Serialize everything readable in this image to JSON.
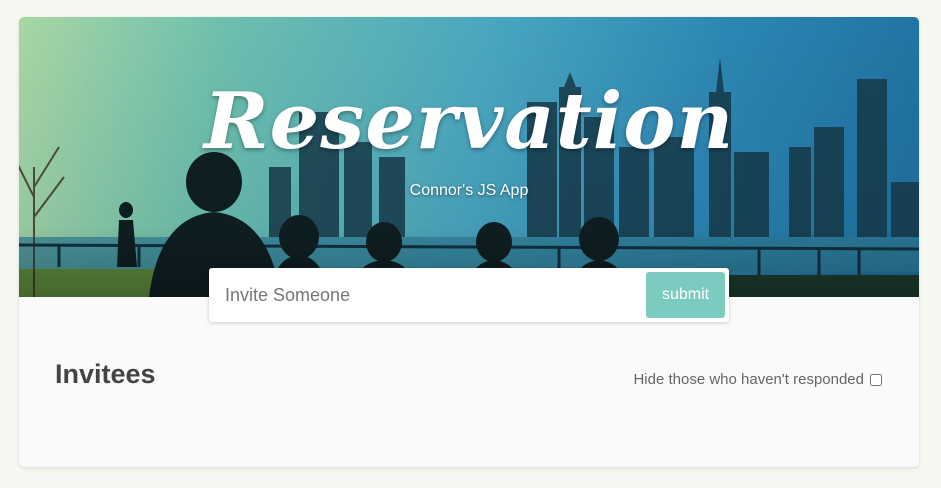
{
  "header": {
    "title": "Reservation",
    "subtitle": "Connor's JS App"
  },
  "form": {
    "placeholder": "Invite Someone",
    "value": "",
    "submit_label": "submit"
  },
  "invitees": {
    "heading": "Invitees",
    "filter_label": "Hide those who haven't responded",
    "filter_checked": false
  },
  "colors": {
    "accent": "#7ccbc1",
    "heading": "#444444"
  }
}
